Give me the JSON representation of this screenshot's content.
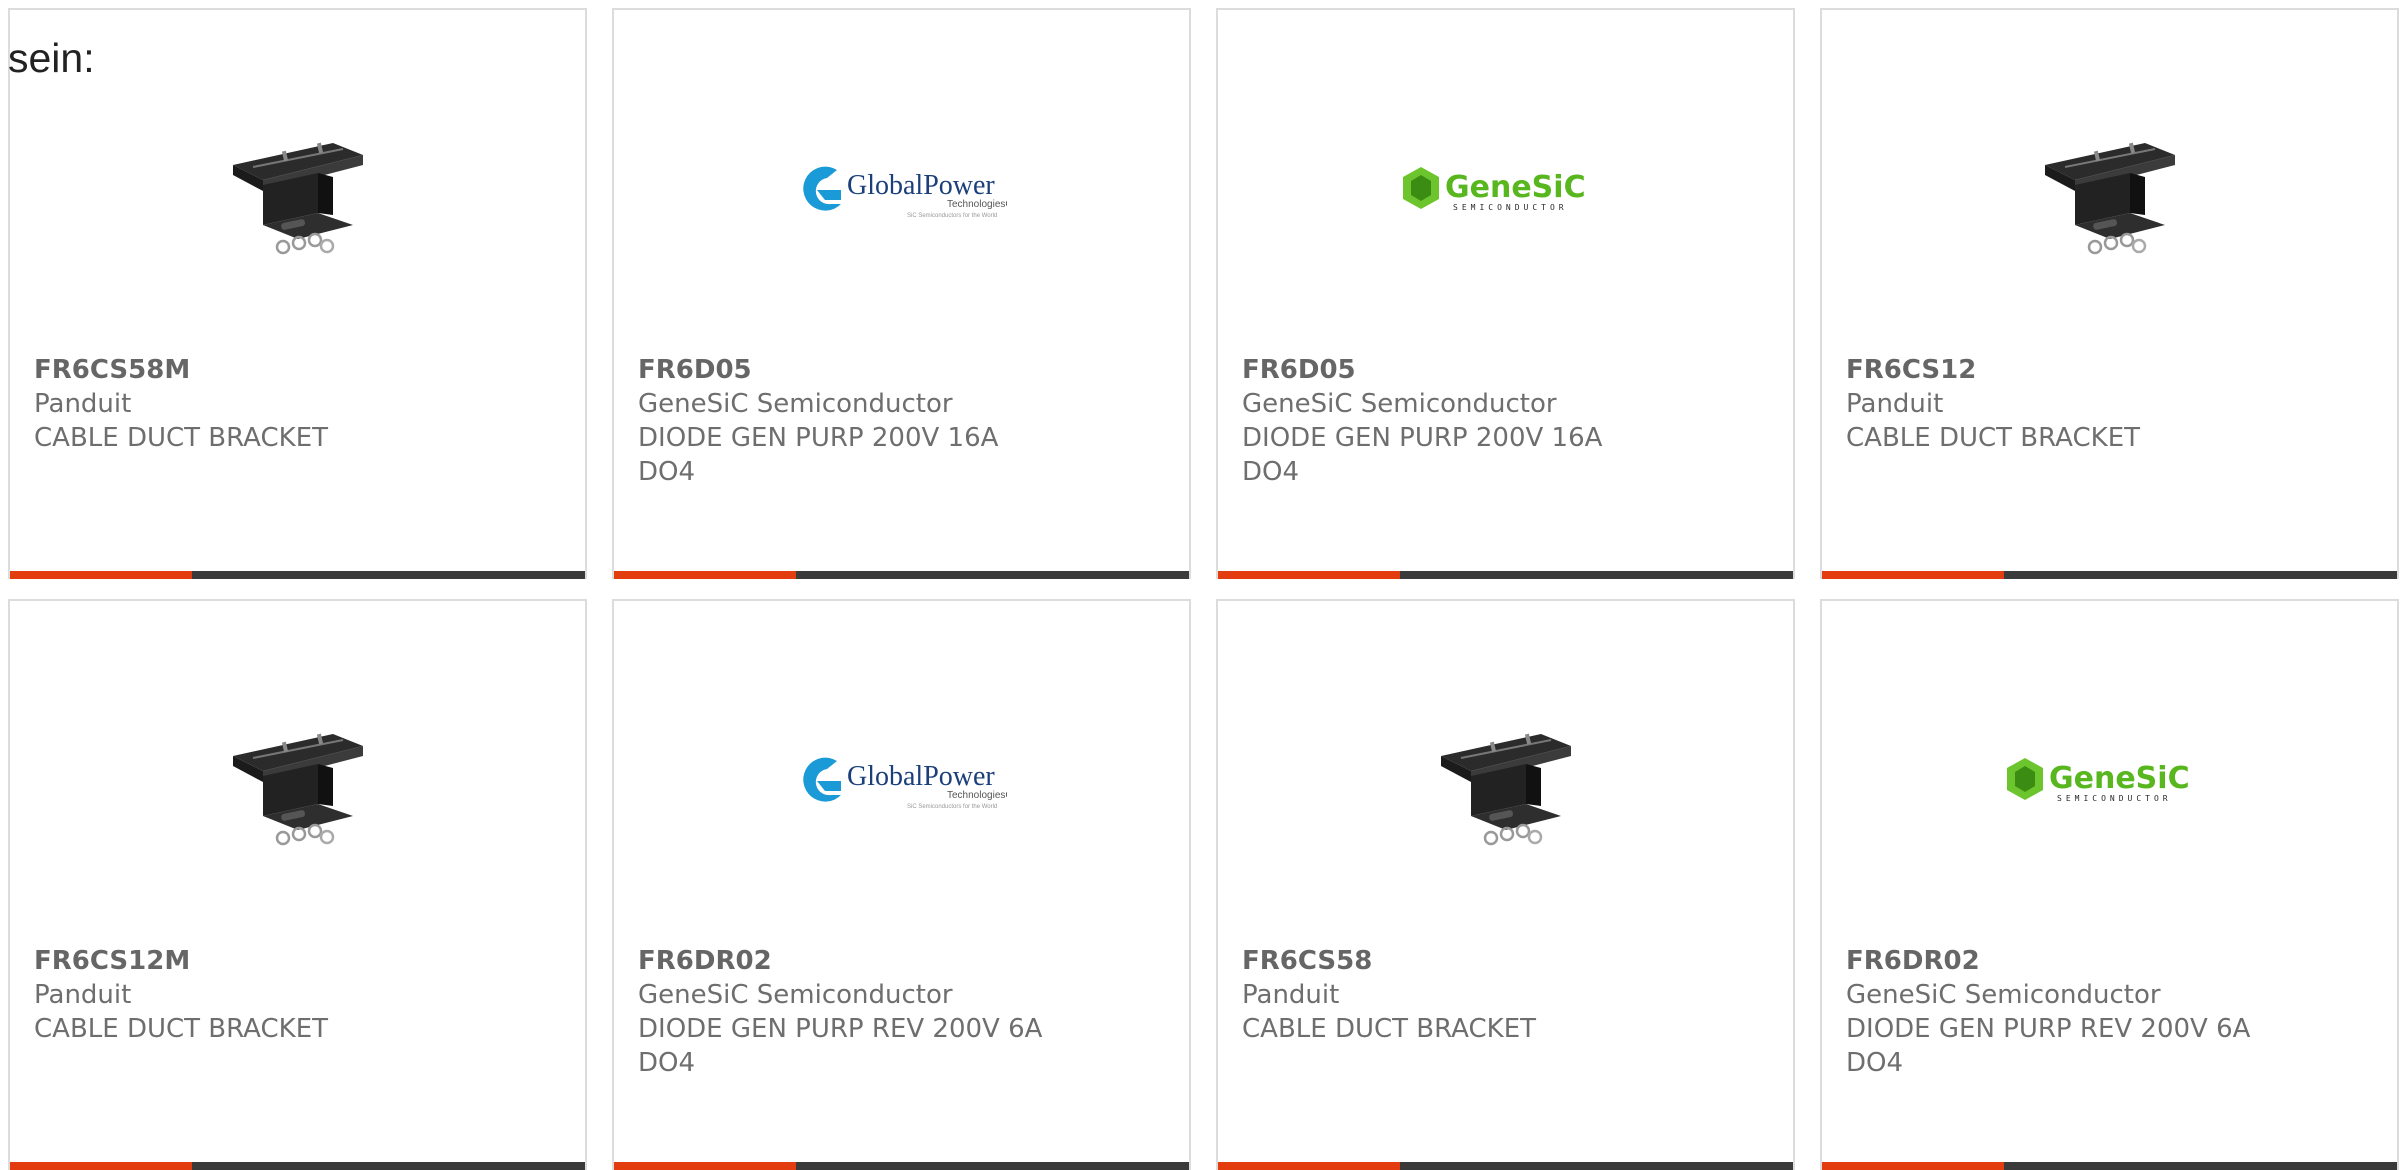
{
  "intro": {
    "text": "sein:"
  },
  "products": [
    {
      "part": "FR6CS58M",
      "manufacturer": "Panduit",
      "description": "CABLE DUCT BRACKET",
      "image": "bracket"
    },
    {
      "part": "FR6D05",
      "manufacturer": "GeneSiC Semiconductor",
      "description": "DIODE GEN PURP 200V 16A DO4",
      "image": "globalpower"
    },
    {
      "part": "FR6D05",
      "manufacturer": "GeneSiC Semiconductor",
      "description": "DIODE GEN PURP 200V 16A DO4",
      "image": "genesic"
    },
    {
      "part": "FR6CS12",
      "manufacturer": "Panduit",
      "description": "CABLE DUCT BRACKET",
      "image": "bracket"
    },
    {
      "part": "FR6CS12M",
      "manufacturer": "Panduit",
      "description": "CABLE DUCT BRACKET",
      "image": "bracket"
    },
    {
      "part": "FR6DR02",
      "manufacturer": "GeneSiC Semiconductor",
      "description": "DIODE GEN PURP REV 200V 6A DO4",
      "image": "globalpower"
    },
    {
      "part": "FR6CS58",
      "manufacturer": "Panduit",
      "description": "CABLE DUCT BRACKET",
      "image": "bracket"
    },
    {
      "part": "FR6DR02",
      "manufacturer": "GeneSiC Semiconductor",
      "description": "DIODE GEN PURP REV 200V 6A DO4",
      "image": "genesic"
    }
  ],
  "logos": {
    "globalpower": {
      "name": "GlobalPower",
      "sub": "TechnologiesGroup",
      "tagline": "SiC Semiconductors for the World"
    },
    "genesic": {
      "name": "GeneSiC",
      "sub": "SEMICONDUCTOR"
    }
  },
  "colors": {
    "accent": "#e23c0f",
    "bar": "#3a3a3a",
    "text": "#6e6e6e",
    "border": "#dcdcdc"
  }
}
